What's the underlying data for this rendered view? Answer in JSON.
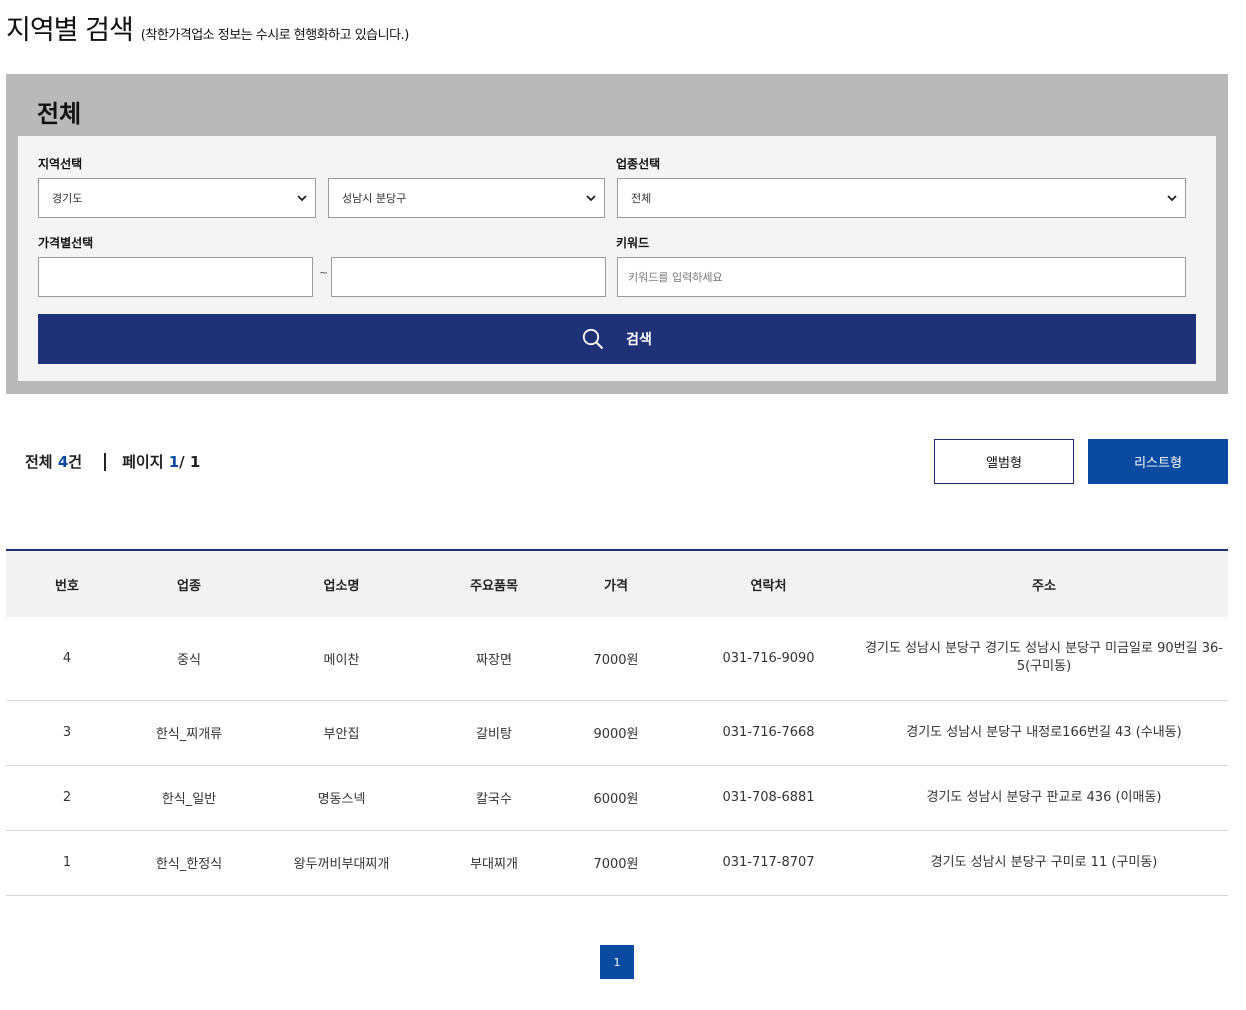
{
  "header": {
    "title": "지역별 검색",
    "subtitle": "(착한가격업소 정보는 수시로 현행화하고 있습니다.)"
  },
  "search": {
    "panel_title": "전체",
    "region_label": "지역선택",
    "region_province": "경기도",
    "region_city": "성남시 분당구",
    "category_label": "업종선택",
    "category_value": "전체",
    "price_label": "가격별선택",
    "price_min": "",
    "price_max": "",
    "price_separator": "~",
    "keyword_label": "키워드",
    "keyword_placeholder": "키워드를 입력하세요",
    "button_label": "검색",
    "colors": {
      "panel": "#b9b9b9",
      "button": "#1f3278"
    }
  },
  "summary": {
    "total_prefix": "전체",
    "total_count": "4",
    "total_suffix": "건",
    "page_label": "페이지",
    "page_current": "1",
    "page_total": "/ 1"
  },
  "view": {
    "album_label": "앨범형",
    "list_label": "리스트형",
    "active": "list",
    "accent": "#0a4aa0"
  },
  "table": {
    "headers": [
      "번호",
      "업종",
      "업소명",
      "주요품목",
      "가격",
      "연락처",
      "주소"
    ],
    "rows": [
      [
        "4",
        "중식",
        "메이찬",
        "짜장면",
        "7000원",
        "031-716-9090",
        "경기도 성남시 분당구 경기도 성남시 분당구 미금일로 90번길 36-5(구미동)"
      ],
      [
        "3",
        "한식_찌개류",
        "부안집",
        "갈비탕",
        "9000원",
        "031-716-7668",
        "경기도 성남시 분당구 내정로166번길 43 (수내동)"
      ],
      [
        "2",
        "한식_일반",
        "명동스넥",
        "칼국수",
        "6000원",
        "031-708-6881",
        "경기도 성남시 분당구 판교로 436 (이매동)"
      ],
      [
        "1",
        "한식_한정식",
        "왕두꺼비부대찌개",
        "부대찌개",
        "7000원",
        "031-717-8707",
        "경기도 성남시 분당구 구미로 11 (구미동)"
      ]
    ]
  },
  "pagination": {
    "pages": [
      "1"
    ],
    "current": "1"
  }
}
